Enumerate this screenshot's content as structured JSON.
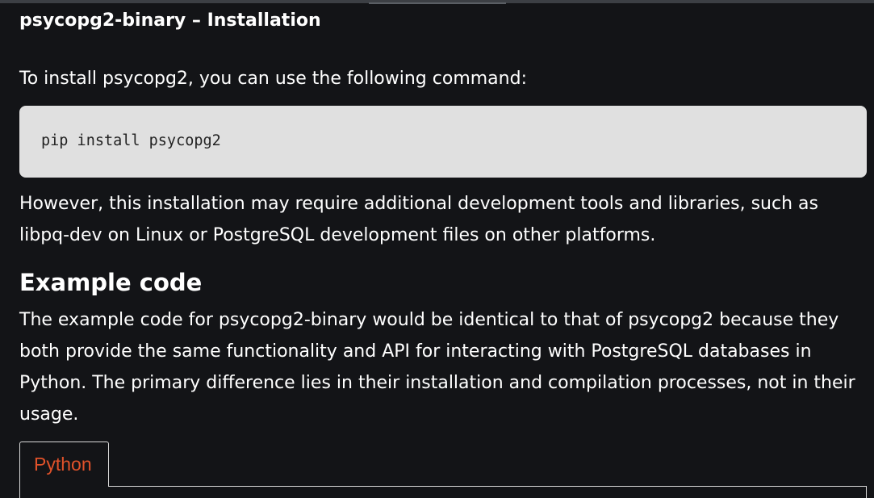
{
  "article": {
    "section_title": "psycopg2-binary – Installation",
    "intro": "To install psycopg2, you can use the following command:",
    "code": "pip install psycopg2",
    "para1": "However, this installation may require additional development tools and libraries, such as libpq-dev on Linux or PostgreSQL development files on other platforms.",
    "example_heading": "Example code",
    "para2": "The example code for psycopg2-binary would be identical to that of psycopg2 because they both provide the same functionality and API for interacting with PostgreSQL databases in Python. The primary difference lies in their installation and compilation processes, not in their usage."
  },
  "code_tabs": {
    "items": [
      {
        "label": "Python",
        "active": true
      }
    ],
    "active_color": "#e0522a"
  },
  "colors": {
    "background": "#131417",
    "text": "#ffffff",
    "code_background": "#e0e0e0",
    "code_text": "#222222"
  }
}
